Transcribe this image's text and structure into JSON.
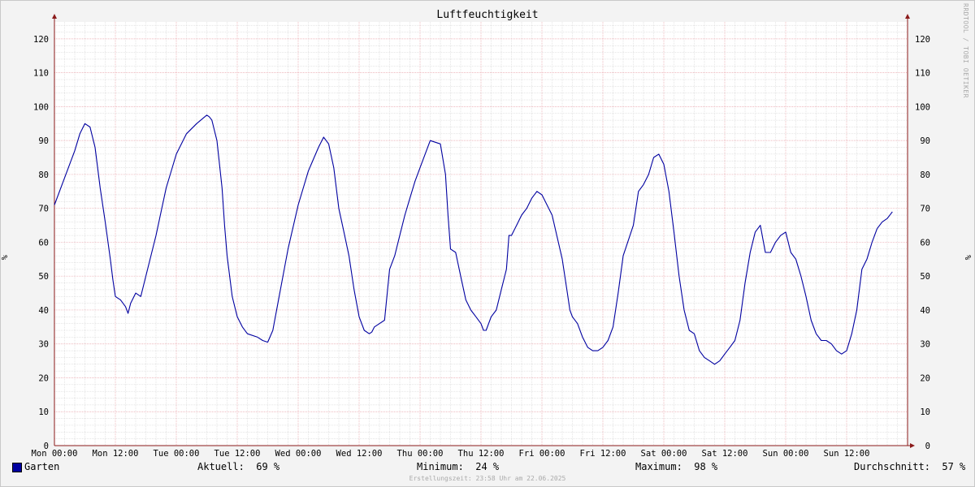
{
  "chart_data": {
    "type": "line",
    "title": "Luftfeuchtigkeit",
    "ylabel": "%",
    "ylim": [
      0,
      125
    ],
    "yticks": [
      0,
      10,
      20,
      30,
      40,
      50,
      60,
      70,
      80,
      90,
      100,
      110,
      120
    ],
    "xlim_hours": [
      0,
      168
    ],
    "xtick_labels": [
      "Mon 00:00",
      "Mon 12:00",
      "Tue 00:00",
      "Tue 12:00",
      "Wed 00:00",
      "Wed 12:00",
      "Thu 00:00",
      "Thu 12:00",
      "Fri 00:00",
      "Fri 12:00",
      "Sat 00:00",
      "Sat 12:00",
      "Sun 00:00",
      "Sun 12:00"
    ],
    "grid": true,
    "series": [
      {
        "name": "Garten",
        "color": "#0000a0",
        "x_hours": [
          0,
          2,
          4,
          5,
          6,
          7,
          8,
          9,
          10,
          11,
          11.5,
          12,
          13,
          14,
          14.5,
          15,
          16,
          17,
          18,
          20,
          22,
          24,
          26,
          28,
          30,
          30.5,
          31,
          32,
          33,
          33.5,
          34,
          35,
          36,
          37,
          38,
          40,
          41,
          42,
          43,
          44,
          46,
          48,
          50,
          52,
          53,
          54,
          55,
          56,
          57,
          58,
          59,
          60,
          61,
          62,
          62.5,
          63,
          64,
          65,
          66,
          67,
          68,
          69,
          70,
          71,
          72,
          74,
          76,
          77,
          77.5,
          78,
          79,
          80,
          81,
          82,
          83,
          84,
          84.5,
          85,
          86,
          87,
          88,
          89,
          89.5,
          90,
          91,
          92,
          93,
          94,
          95,
          96,
          98,
          100,
          101,
          101.5,
          102,
          103,
          104,
          105,
          106,
          107,
          108,
          109,
          110,
          111,
          112,
          114,
          115,
          116,
          117,
          118,
          119,
          120,
          121,
          122,
          123,
          124,
          125,
          126,
          127,
          128,
          129,
          130,
          131,
          132,
          133,
          134,
          135,
          136,
          137,
          138,
          139,
          140,
          141,
          142,
          143,
          144,
          145,
          146,
          147,
          148,
          149,
          150,
          151,
          152,
          153,
          154,
          155,
          156,
          157,
          158,
          159,
          160,
          161,
          162,
          163,
          164,
          165,
          166,
          167,
          168
        ],
        "values": [
          71,
          79,
          87,
          92,
          95,
          94,
          88,
          76,
          66,
          55,
          49,
          44,
          43,
          41,
          39,
          42,
          45,
          44,
          50,
          62,
          76,
          86,
          92,
          95,
          97.5,
          97,
          96,
          90,
          76,
          65,
          56,
          44,
          38,
          35,
          33,
          32,
          31,
          30.5,
          34,
          42,
          58,
          71,
          81,
          88,
          91,
          89,
          82,
          70,
          63,
          56,
          46,
          38,
          34,
          33,
          33.5,
          35,
          36,
          37,
          52,
          56,
          62,
          68,
          73,
          78,
          82,
          90,
          89,
          80,
          68,
          58,
          57,
          50,
          43,
          40,
          38,
          36,
          34,
          34,
          38,
          40,
          46,
          52,
          62,
          62,
          65,
          68,
          70,
          73,
          75,
          74,
          68,
          55,
          45,
          40,
          38,
          36,
          32,
          29,
          28,
          28,
          29,
          31,
          35,
          45,
          56,
          65,
          75,
          77,
          80,
          85,
          86,
          83,
          75,
          63,
          50,
          40,
          34,
          33,
          28,
          26,
          25,
          24,
          25,
          27,
          29,
          31,
          37,
          48,
          57,
          63,
          65,
          57,
          57,
          60,
          62,
          63,
          57,
          55,
          50,
          44,
          37,
          33,
          31,
          31,
          30,
          28,
          27,
          28,
          33,
          40,
          52,
          55,
          60,
          64,
          66,
          67,
          69
        ]
      }
    ]
  },
  "legend": {
    "series_name": "Garten",
    "swatch_color": "#0000a0"
  },
  "stats": {
    "current": "Aktuell:  69 %",
    "minimum": "Minimum:  24 %",
    "maximum": "Maximum:  98 %",
    "average": "Durchschnitt:  57 %"
  },
  "watermark": "RRDTOOL / TOBI OETIKER",
  "footer": "Erstellungszeit: 23:58 Uhr am 22.06.2025",
  "colors": {
    "major_grid": "#e8a0a8",
    "minor_grid": "#cccccc",
    "line": "#0000a0",
    "axis_arrow": "#8b1a1a"
  }
}
